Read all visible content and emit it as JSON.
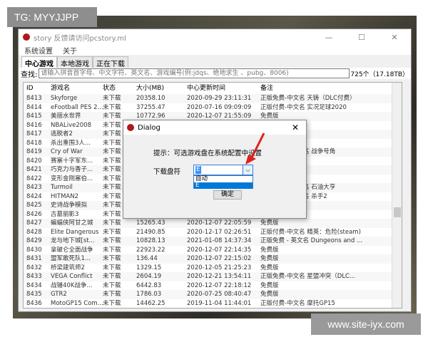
{
  "overlay_tag": "TG: MYYJJPP",
  "watermark": "www.site-iyx.com",
  "window": {
    "title": "story 反馈请访问pcstory.ml",
    "minimize": "—",
    "maximize": "☐",
    "close": "✕"
  },
  "menu": [
    "系统设置",
    "关于"
  ],
  "tabs": [
    {
      "label": "中心游戏",
      "active": true
    },
    {
      "label": "本地游戏"
    },
    {
      "label": "正在下载"
    }
  ],
  "search": {
    "label": "查找:",
    "placeholder": "请输入拼音首字母、中文字符、英文名、游戏编号(例:jdqs、绝地求生 、pubg、8006)",
    "count": "725个（17.18TB）"
  },
  "table": {
    "headers": [
      "ID",
      "游戏名",
      "状态",
      "大小(MB)",
      "中心更新时间",
      "备注"
    ],
    "rows": [
      [
        "8413",
        "Skyforge",
        "未下载",
        "20358.10",
        "2020-09-29 23:11:31",
        "正版免费-中文名 天铸（DLC付费）"
      ],
      [
        "8414",
        "eFootball PES 2...",
        "未下载",
        "37255.47",
        "2020-07-16 09:09:09",
        "正版付费-中文名 实况足球2020"
      ],
      [
        "8415",
        "美丽水世界",
        "未下载",
        "10772.96",
        "2020-12-07 21:55:09",
        "免费版"
      ],
      [
        "8416",
        "NBALive2008",
        "未下载",
        "",
        "",
        ""
      ],
      [
        "8417",
        "逃脱者2",
        "未下载",
        "",
        "",
        ""
      ],
      [
        "8418",
        "杀出重围3人...",
        "未下载",
        "",
        "",
        ""
      ],
      [
        "8419",
        "Cry of War",
        "未下载",
        "",
        "",
        "名 战争号角"
      ],
      [
        "8420",
        "赛塞十字军东...",
        "未下载",
        "",
        "",
        ""
      ],
      [
        "8421",
        "巧克力与香子...",
        "未下载",
        "",
        "",
        ""
      ],
      [
        "8422",
        "变形金刚塞伯...",
        "未下载",
        "",
        "",
        ""
      ],
      [
        "8423",
        "Turmoil",
        "未下载",
        "",
        "",
        "名 石油大亨"
      ],
      [
        "8424",
        "HITMAN2",
        "未下载",
        "",
        "",
        "名 杀手2"
      ],
      [
        "8425",
        "史诗战争模拟",
        "未下载",
        "",
        "",
        ""
      ],
      [
        "8426",
        "古墓丽影3",
        "未下载",
        "",
        "",
        ""
      ],
      [
        "8427",
        "蝙蝠侠阿甘之城",
        "未下载",
        "15265.43",
        "2020-12-07 22:05:59",
        "免费版"
      ],
      [
        "8428",
        "Elite Dangerous",
        "未下载",
        "21490.85",
        "2020-12-17 02:26:51",
        "正版付费-中文名 精英：危险(steam)"
      ],
      [
        "8429",
        "龙与地下城[st...",
        "未下载",
        "10828.13",
        "2021-01-08 14:37:34",
        "正版免费 - 英文名 Dungeons and ..."
      ],
      [
        "8430",
        "拿破仑全面战争",
        "未下载",
        "22923.22",
        "2020-12-07 22:14:35",
        "免费版"
      ],
      [
        "8431",
        "盟军敢死队1...",
        "未下载",
        "136.44",
        "2020-12-07 22:15:02",
        "免费版"
      ],
      [
        "8432",
        "桥梁建筑师2",
        "未下载",
        "1329.15",
        "2020-12-05 21:25:23",
        "免费版"
      ],
      [
        "8433",
        "VEGA Conflict",
        "未下载",
        "2604.19",
        "2020-12-21 13:54:11",
        "正版免费-中文名 星盟冲突（DLC..."
      ],
      [
        "8434",
        "战锤40K战争...",
        "未下载",
        "6442.83",
        "2020-12-07 22:18:12",
        "免费版"
      ],
      [
        "8435",
        "GTR2",
        "未下载",
        "1786.03",
        "2020-07-25 08:40:47",
        "免费版"
      ],
      [
        "8436",
        "MotoGP15 Com...",
        "未下载",
        "14462.25",
        "2019-11-04 11:44:01",
        "正版付费-中文名 摩托GP15"
      ]
    ]
  },
  "dialog": {
    "title": "Dialog",
    "close": "✕",
    "hint": "提示：可选游戏盘在系统配置中设置",
    "drive_label": "下载盘符",
    "drive_value": "E",
    "options": [
      "自动",
      "E"
    ],
    "selected_option": "E",
    "ok": "确定"
  },
  "colors": {
    "selection": "#0078d7",
    "arrow": "#e02020"
  }
}
